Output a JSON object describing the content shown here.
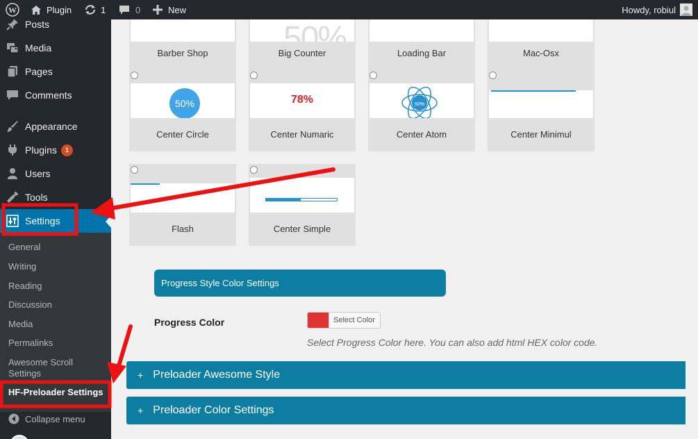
{
  "adminbar": {
    "site_name": "Plugin",
    "updates_count": "1",
    "comments_count": "0",
    "new_label": "New",
    "greeting": "Howdy, robiul"
  },
  "sidebar": {
    "items": [
      {
        "label": "Posts",
        "icon": "pin-icon"
      },
      {
        "label": "Media",
        "icon": "media-icon"
      },
      {
        "label": "Pages",
        "icon": "pages-icon"
      },
      {
        "label": "Comments",
        "icon": "comment-icon"
      },
      {
        "label": "Appearance",
        "icon": "brush-icon"
      },
      {
        "label": "Plugins",
        "icon": "plugin-icon",
        "badge": "1"
      },
      {
        "label": "Users",
        "icon": "user-icon"
      },
      {
        "label": "Tools",
        "icon": "wrench-icon"
      },
      {
        "label": "Settings",
        "icon": "settings-icon"
      }
    ],
    "submenu": [
      "General",
      "Writing",
      "Reading",
      "Discussion",
      "Media",
      "Permalinks",
      "Awesome Scroll Settings",
      "HF-Preloader Settings"
    ],
    "collapse_label": "Collapse menu"
  },
  "styles": {
    "row0": [
      "Barber Shop",
      "Big Counter",
      "Loading Bar",
      "Mac-Osx"
    ],
    "row1": [
      "Center Circle",
      "Center Numaric",
      "Center Atom",
      "Center Minimul"
    ],
    "row2": [
      "Flash",
      "Center Simple"
    ],
    "preview_circle_text": "50%",
    "preview_numeric_text": "78%",
    "preview_atom_text": "50%"
  },
  "progress_section": {
    "heading": "Progress Style Color Settings",
    "color_label": "Progress Color",
    "select_color_label": "Select Color",
    "color_value": "#dd3333",
    "help_text": "Select Progress Color here. You can also add html HEX color code."
  },
  "accordions": [
    {
      "symbol": "+",
      "label": "Preloader Awesome Style"
    },
    {
      "symbol": "+",
      "label": "Preloader Color Settings"
    }
  ],
  "colors": {
    "admin_dark": "#23282d",
    "accent_blue": "#0073aa",
    "section_blue": "#0d7ea1",
    "annotation_red": "#ee1111"
  }
}
